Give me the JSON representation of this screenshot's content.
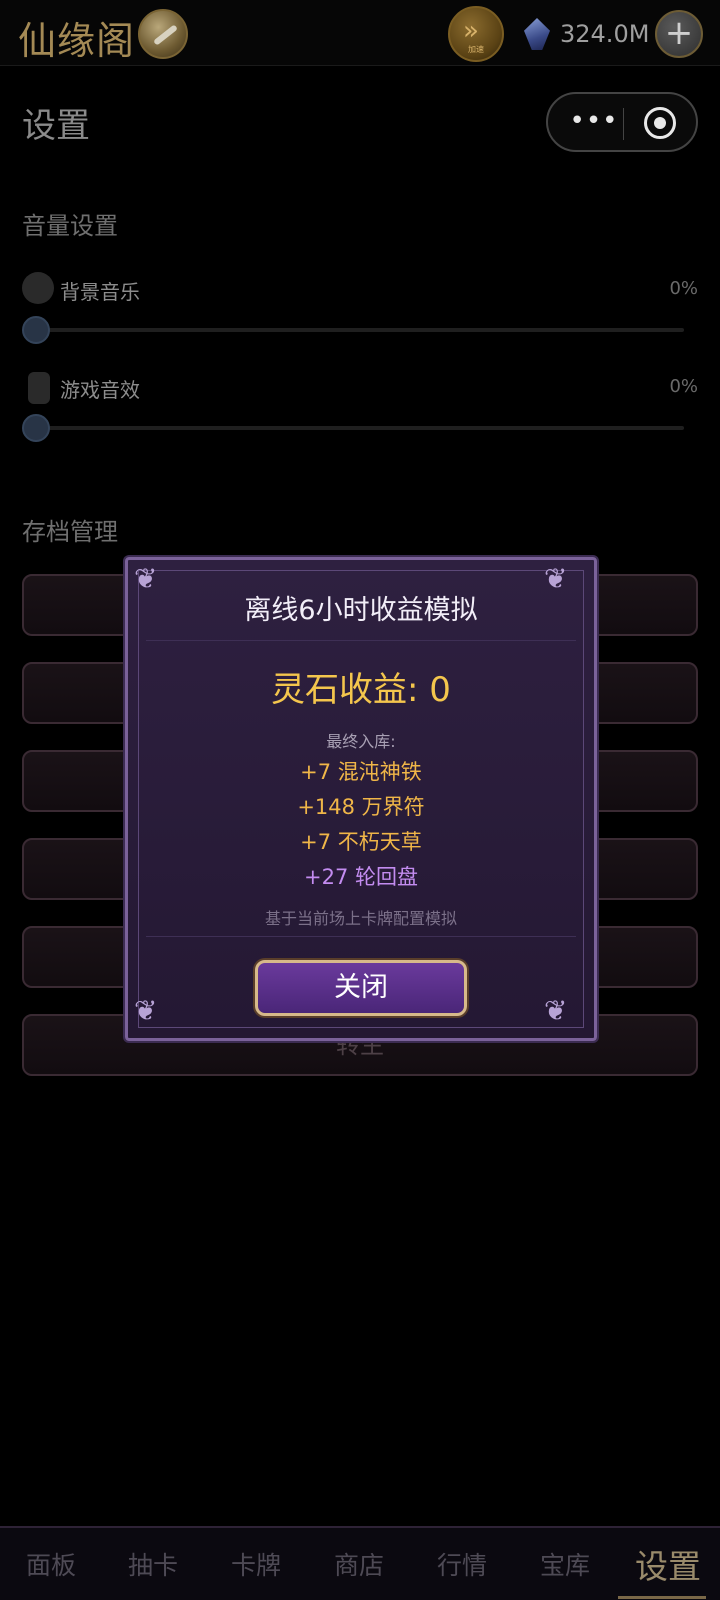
{
  "topbar": {
    "app_title": "仙缘阁",
    "logo_icon": "sword-coin-icon",
    "speed_label": "加速",
    "currency_value": "324.0M",
    "currency_icon": "spirit-gem-icon",
    "add_icon": "plus-icon"
  },
  "page": {
    "title": "设置",
    "menu_icon": "more-dots-icon",
    "close_icon": "target-circle-icon"
  },
  "settings": {
    "volume_section": "音量设置",
    "music_label": "背景音乐",
    "music_value": "0%",
    "music_level": 0,
    "sfx_label": "游戏音效",
    "sfx_value": "0%",
    "sfx_level": 0,
    "save_section": "存档管理",
    "rebirth_label": "转生"
  },
  "modal": {
    "title": "离线6小时收益模拟",
    "income": "灵石收益: 0",
    "final_label": "最终入库:",
    "items": [
      {
        "text": "+7 混沌神铁",
        "color": "#f0b648"
      },
      {
        "text": "+148 万界符",
        "color": "#f0b648"
      },
      {
        "text": "+7 不朽天草",
        "color": "#f0b648"
      },
      {
        "text": "+27 轮回盘",
        "color": "#c38cf0"
      }
    ],
    "footnote": "基于当前场上卡牌配置模拟",
    "close_label": "关闭"
  },
  "bottom_nav": {
    "items": [
      "面板",
      "抽卡",
      "卡牌",
      "商店",
      "行情",
      "宝库",
      "设置"
    ],
    "active_index": 6
  },
  "colors": {
    "accent_gold": "#f4c64d",
    "modal_bg": "#2e2040",
    "purple_item": "#c38cf0"
  }
}
